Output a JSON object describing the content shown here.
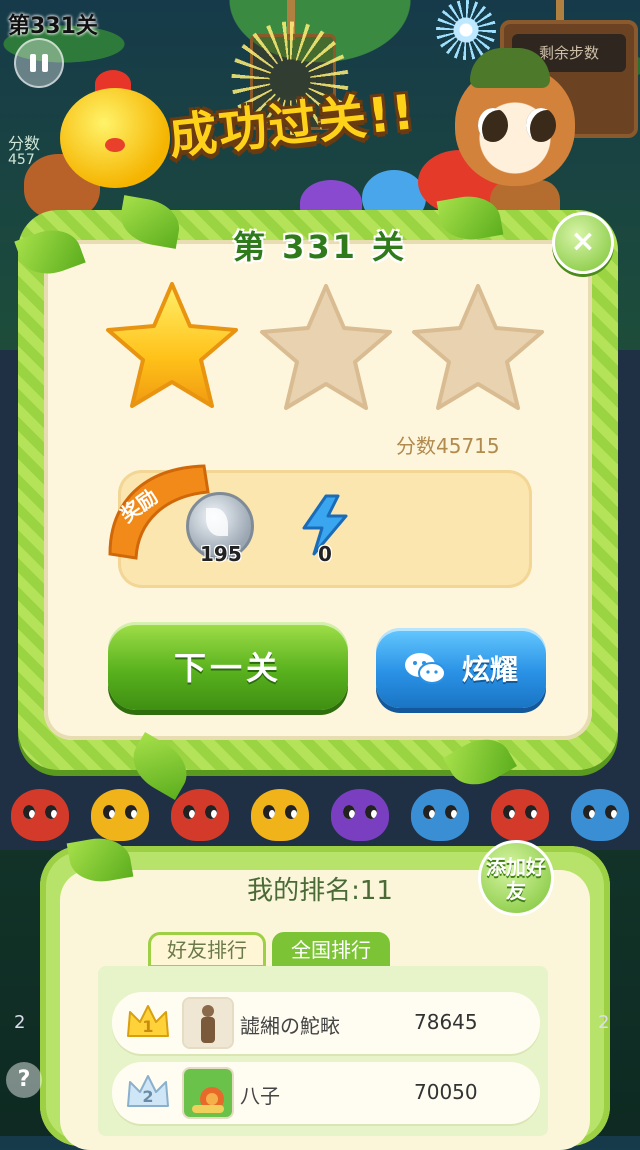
{
  "hud": {
    "level_label": "第331关",
    "score_label": "分数",
    "score_value": "457",
    "moves_label": "剩余步数",
    "left_num": "2",
    "right_num": "2",
    "help_label": "?"
  },
  "celebration": {
    "title": "成功过关!!"
  },
  "dialog": {
    "level_title": "第 331 关",
    "close_label": "×",
    "stars_earned": 1,
    "stars_total": 3,
    "score_text": "分数45715",
    "reward_label": "奖励",
    "rewards": [
      {
        "icon": "silver-leaf-coin-icon",
        "count": "195"
      },
      {
        "icon": "lightning-bolt-icon",
        "count": "0"
      }
    ],
    "next_button": "下一关",
    "share_button": "炫耀"
  },
  "ranking": {
    "my_rank": "我的排名:11",
    "add_friend": "添加好友",
    "tabs": [
      "好友排行",
      "全国排行"
    ],
    "entries": [
      {
        "rank": "1",
        "name": "譃緗の鮀畩",
        "score": "78645"
      },
      {
        "rank": "2",
        "name": "八子",
        "score": "70050"
      }
    ]
  },
  "colors": {
    "vine_green": "#9bd443",
    "panel_cream": "#fdf6dc",
    "next_green": "#59b21e",
    "share_blue": "#2a92e6",
    "star_gold": "#ffc21a",
    "star_empty": "#e8d2b0"
  }
}
